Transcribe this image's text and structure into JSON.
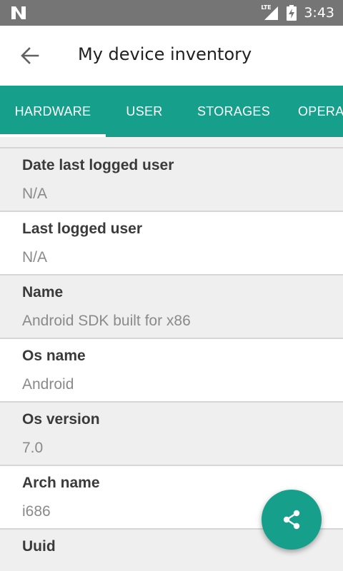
{
  "status_bar": {
    "left_icon": "n-notification-icon",
    "network_label": "LTE",
    "signal_icon": "signal-icon",
    "battery_icon": "battery-charging-icon",
    "time": "3:43",
    "background_color": "#757575"
  },
  "toolbar": {
    "back_icon": "arrow-back-icon",
    "title": "My device inventory"
  },
  "tabs": {
    "accent_color": "#169F8A",
    "items": [
      {
        "label": "HARDWARE",
        "selected": true
      },
      {
        "label": "USER",
        "selected": false
      },
      {
        "label": "STORAGES",
        "selected": false
      },
      {
        "label": "OPERA",
        "selected": false
      }
    ]
  },
  "details": [
    {
      "label": "Date last logged user",
      "value": "N/A"
    },
    {
      "label": "Last logged user",
      "value": "N/A"
    },
    {
      "label": "Name",
      "value": "Android SDK built for x86"
    },
    {
      "label": "Os name",
      "value": "Android"
    },
    {
      "label": "Os version",
      "value": "7.0"
    },
    {
      "label": "Arch name",
      "value": "i686"
    },
    {
      "label": "Uuid",
      "value": ""
    }
  ],
  "fab": {
    "icon": "share-icon"
  }
}
